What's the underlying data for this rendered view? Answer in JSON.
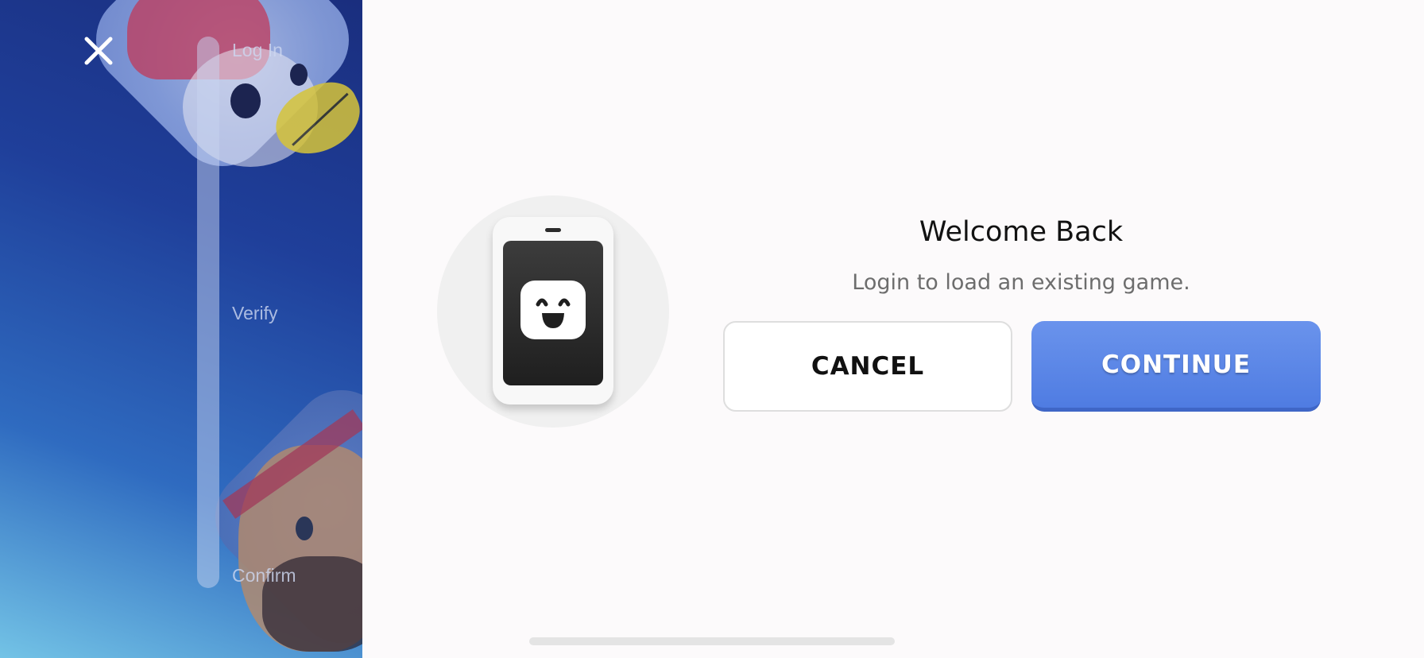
{
  "sidebar": {
    "steps": [
      {
        "label": "Log In"
      },
      {
        "label": "Verify"
      },
      {
        "label": "Confirm"
      }
    ],
    "close_icon": "close-icon"
  },
  "dialog": {
    "title": "Welcome Back",
    "subtitle": "Login to load an existing game.",
    "cancel_label": "CANCEL",
    "continue_label": "CONTINUE",
    "illustration_icon": "phone-smiley-icon"
  },
  "colors": {
    "accent": "#5583e6",
    "background": "#fcfafb",
    "sidebar": "#1f3f9a"
  }
}
